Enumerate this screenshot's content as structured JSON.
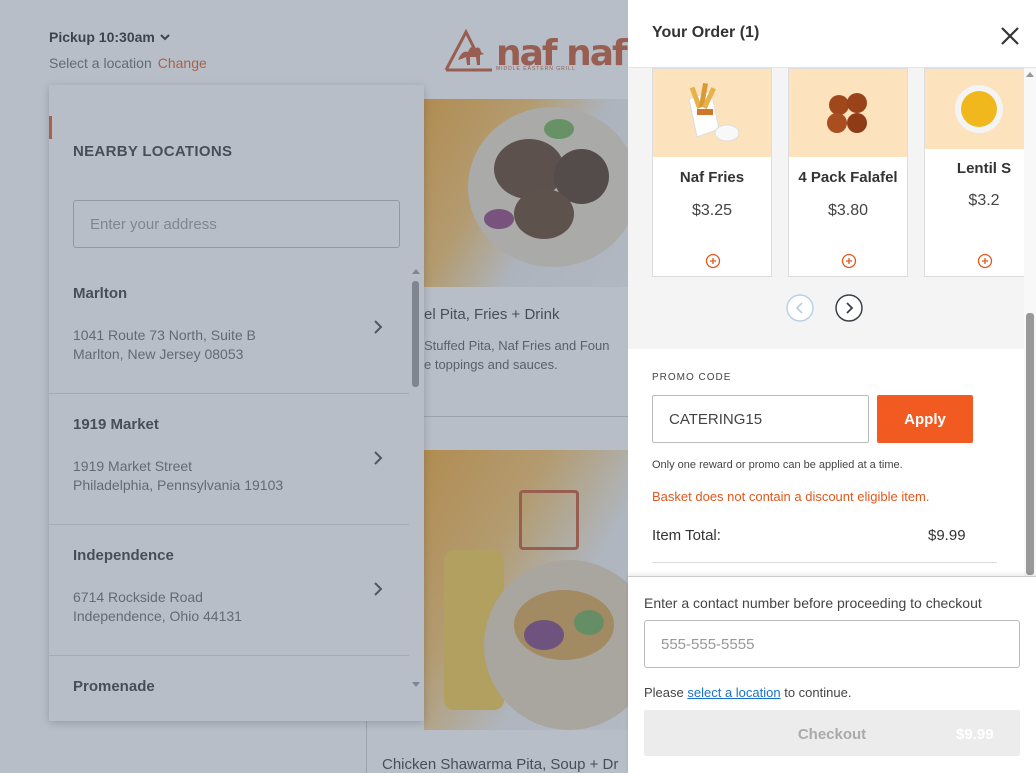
{
  "header": {
    "pickup_label": "Pickup 10:30am",
    "select_location_text": "Select a location",
    "change_link": "Change",
    "logo_text": "naf naf",
    "logo_subtext": "MIDDLE EASTERN GRILL"
  },
  "locations": {
    "title": "NEARBY LOCATIONS",
    "address_placeholder": "Enter your address",
    "items": [
      {
        "name": "Marlton",
        "address_line1": "1041 Route 73 North, Suite B",
        "address_line2": "Marlton, New Jersey 08053"
      },
      {
        "name": "1919 Market",
        "address_line1": "1919 Market Street",
        "address_line2": "Philadelphia, Pennsylvania 19103"
      },
      {
        "name": "Independence",
        "address_line1": "6714 Rockside Road",
        "address_line2": "Independence, Ohio 44131"
      },
      {
        "name": "Promenade"
      }
    ]
  },
  "menu": {
    "meal1_title": "el Pita, Fries + Drink",
    "meal1_desc_line1": " Stuffed Pita, Naf Fries and Foun",
    "meal1_desc_line2": "e toppings and sauces.",
    "meal2_title": "Chicken Shawarma Pita, Soup + Dr"
  },
  "order": {
    "title": "Your Order (1)",
    "upsell_items": [
      {
        "name": "Naf Fries",
        "price": "$3.25"
      },
      {
        "name": "4 Pack Falafel",
        "price": "$3.80"
      },
      {
        "name": "Lentil S",
        "price": "$3.2"
      }
    ],
    "promo_label": "PROMO CODE",
    "promo_value": "CATERING15",
    "apply_label": "Apply",
    "promo_note": "Only one reward or promo can be applied at a time.",
    "promo_error": "Basket does not contain a discount eligible item.",
    "item_total_label": "Item Total:",
    "item_total_value": "$9.99",
    "contact_label": "Enter a contact number before proceeding to checkout",
    "phone_placeholder": "555-555-5555",
    "location_note_prefix": "Please ",
    "location_note_link": "select a location",
    "location_note_suffix": " to continue.",
    "checkout_label": "Checkout",
    "checkout_amount": "$9.99"
  },
  "colors": {
    "accent": "#f15b22",
    "brand": "#c8502a",
    "link": "#1a73c9",
    "card_image_bg": "#fde3bd"
  }
}
